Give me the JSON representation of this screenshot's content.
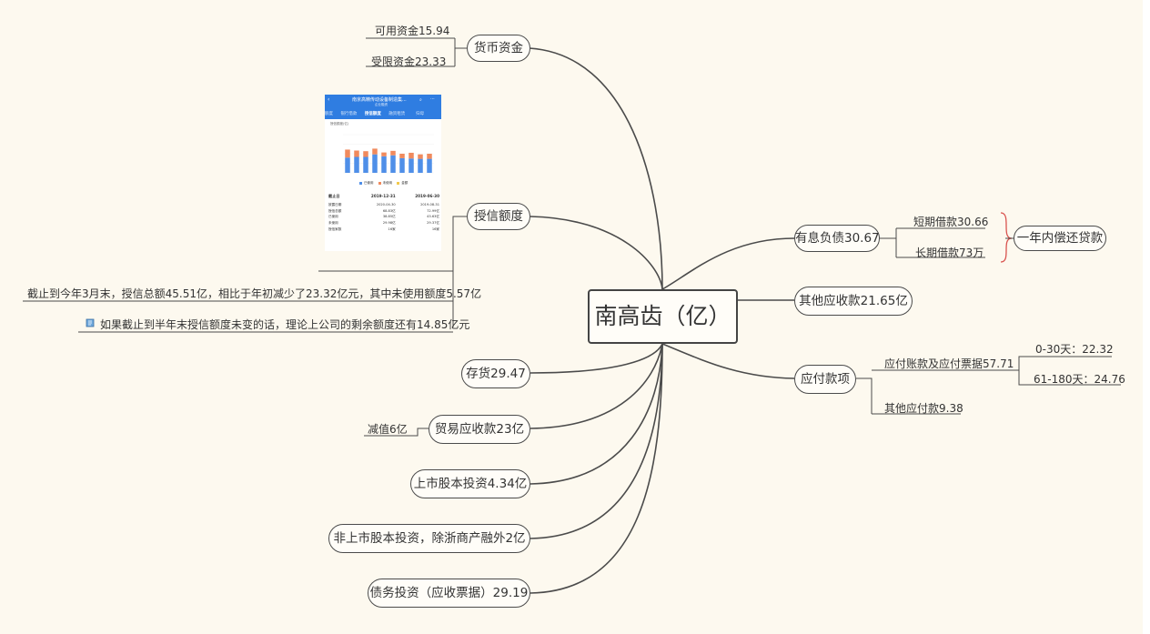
{
  "central": "南高齿（亿）",
  "branches": {
    "huobi": {
      "label": "货币资金",
      "subs": [
        "可用资金15.94",
        "受限资金23.33"
      ]
    },
    "shouxin": {
      "label": "授信额度",
      "notes": [
        "截止到今年3月末，授信总额45.51亿，相比于年初减少了23.32亿元，其中未使用额度5.57亿",
        "如果截止到半年末授信额度未变的话，理论上公司的剩余额度还有14.85亿元"
      ]
    },
    "cunhuo": {
      "label": "存货29.47"
    },
    "maoyi": {
      "label": "贸易应收款23亿",
      "subs": [
        "减值6亿"
      ]
    },
    "shangshi": {
      "label": "上市股本投资4.34亿"
    },
    "feishangshi": {
      "label": "非上市股本投资，除浙商产融外2亿"
    },
    "zhaiwu": {
      "label": "债务投资（应收票据）29.19"
    },
    "youxi": {
      "label": "有息负债30.67",
      "subs": [
        "短期借款30.66",
        "长期借款73万"
      ],
      "summary": "一年内偿还贷款"
    },
    "qita": {
      "label": "其他应收款21.65亿"
    },
    "yingfu": {
      "label": "应付款项",
      "subs": [
        "应付账款及应付票据57.71",
        "其他应付款9.38"
      ],
      "aging": [
        "0-30天：22.32",
        "61-180天：24.76"
      ]
    }
  },
  "thumbnail": {
    "title": "南京高精传动设备制造集...",
    "subtitle": "企业融资",
    "tabs": [
      "额度",
      "银行借款",
      "授信额度",
      "融资租赁"
    ],
    "active_tab": "授信额度",
    "right_tab": "归母",
    "y_label": "授信额度(亿)",
    "legend": [
      "已使用",
      "未使用",
      "金额"
    ],
    "table_header": [
      "截止日",
      "2019-12-31",
      "2019-06-30"
    ],
    "table_rows": [
      [
        "披露日期",
        "2020-04-30",
        "2019-08-31"
      ],
      [
        "授信总额",
        "68.83亿",
        "72.99亿"
      ],
      [
        "已使用",
        "38.85亿",
        "43.63亿"
      ],
      [
        "未使用",
        "29.98亿",
        "29.37亿"
      ],
      [
        "授信家数",
        "16家",
        "16家"
      ]
    ],
    "colors": {
      "used": "#4f8fe8",
      "unused": "#f08a5d",
      "header": "#2f7de1"
    },
    "chart_data": {
      "type": "bar",
      "stacked": true,
      "series": [
        {
          "name": "已使用",
          "values": [
            48,
            50,
            50,
            58,
            52,
            55,
            46,
            45,
            44,
            44
          ]
        },
        {
          "name": "未使用",
          "values": [
            25,
            20,
            18,
            18,
            12,
            14,
            14,
            18,
            14,
            16
          ]
        }
      ],
      "ylim": [
        0,
        120
      ]
    }
  },
  "colors": {
    "background": "#fdf9ef",
    "line": "#4b4b4b",
    "brace": "#d9534f"
  }
}
